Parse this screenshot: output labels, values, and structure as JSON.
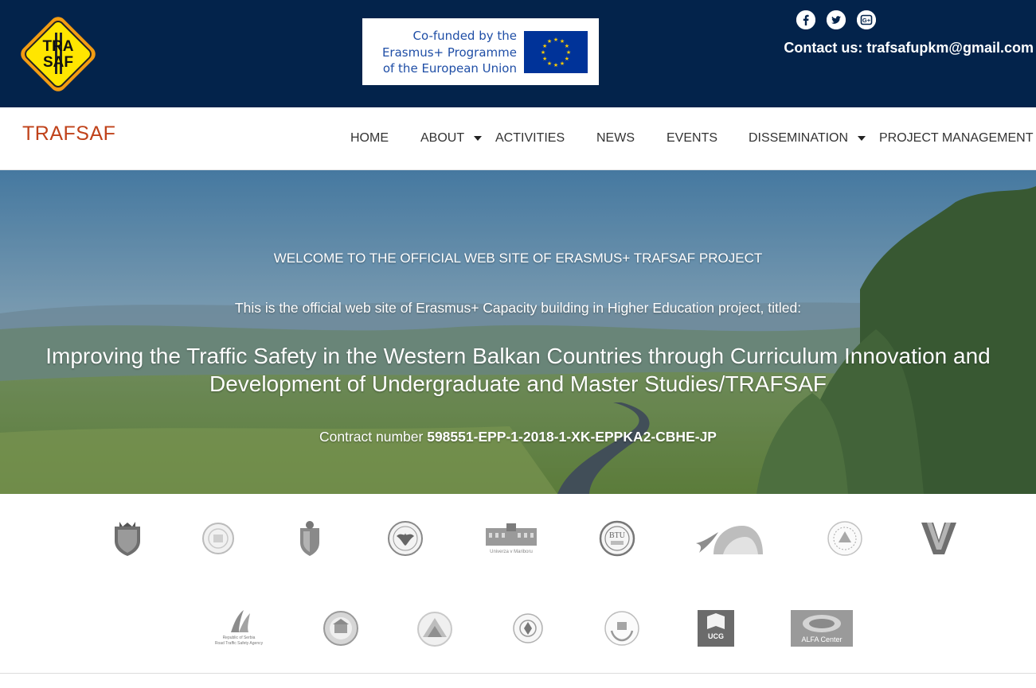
{
  "header": {
    "logo_text": "TRAFSAF",
    "eu_funding": {
      "line1": "Co-funded by the",
      "line2": "Erasmus+ Programme",
      "line3": "of the European Union"
    },
    "social": [
      {
        "name": "facebook",
        "glyph": "f"
      },
      {
        "name": "twitter",
        "glyph": "t"
      },
      {
        "name": "google-plus",
        "glyph": "G+"
      }
    ],
    "contact": "Contact us: trafsafupkm@gmail.com"
  },
  "nav": {
    "brand": "TRAFSAF",
    "items": [
      {
        "label": "HOME",
        "dropdown": false
      },
      {
        "label": "ABOUT",
        "dropdown": true
      },
      {
        "label": "ACTIVITIES",
        "dropdown": false
      },
      {
        "label": "NEWS",
        "dropdown": false
      },
      {
        "label": "EVENTS",
        "dropdown": false
      },
      {
        "label": "DISSEMINATION",
        "dropdown": true
      },
      {
        "label": "PROJECT MANAGEMENT",
        "dropdown": false
      }
    ]
  },
  "hero": {
    "welcome": "WELCOME TO THE OFFICIAL WEB SITE OF ERASMUS+ TRAFSAF PROJECT",
    "intro": "This is the official web site of Erasmus+ Capacity building in Higher Education project, titled:",
    "title_line1": "Improving the Traffic Safety in the Western Balkan Countries through Curriculum Innovation and",
    "title_line2": "Development of Undergraduate and Master Studies/TRAFSAF",
    "contract_label": "Contract number ",
    "contract_number": "598551-EPP-1-2018-1-XK-EPPKA2-CBHE-JP"
  },
  "partners": {
    "row1": [
      "shield-crest-logo",
      "round-seal-logo",
      "coat-of-arms-logo",
      "eagle-seal-logo",
      "univerza-v-mariboru-logo",
      "btu-round-logo",
      "swoosh-logo",
      "university-seal-logo",
      "v-monogram-logo"
    ],
    "row2": [
      "road-traffic-safety-agency-logo",
      "round-building-seal-logo",
      "triangle-mountain-logo",
      "small-round-logo",
      "wreath-seal-logo",
      "ucg-logo",
      "alfa-center-logo"
    ],
    "captions": {
      "maribor": "Univerza v Mariboru",
      "btu": "BTU",
      "rtsa_line1": "Republic of Serbia",
      "rtsa_line2": "Road Traffic Safety Agency",
      "ucg": "UCG",
      "alfa": "ALFA Center"
    }
  },
  "colors": {
    "topbar": "#03234b",
    "brand": "#c0421a",
    "eu_blue": "#003399",
    "eu_text": "#1f4ea6",
    "eu_star": "#ffcc00",
    "logo_yellow": "#ffe600",
    "logo_orange": "#f39c12"
  }
}
